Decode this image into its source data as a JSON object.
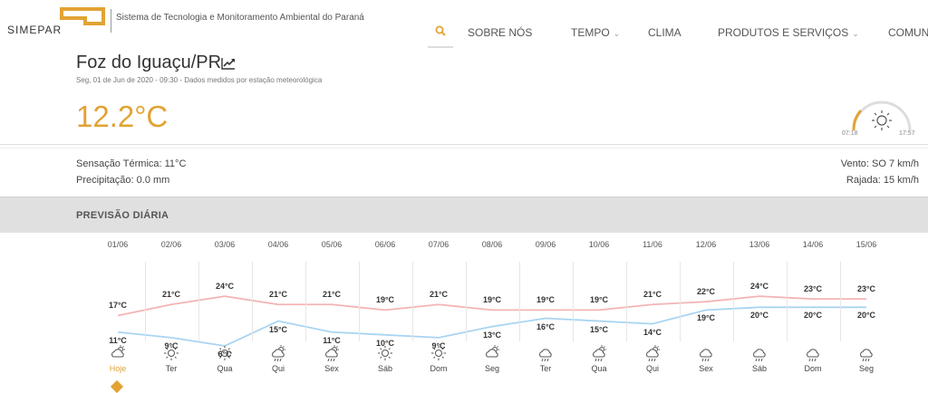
{
  "header": {
    "logo_text": "SIMEPAR",
    "tagline": "Sistema de Tecnologia e Monitoramento Ambiental do Paraná",
    "nav": [
      {
        "label": "SOBRE NÓS",
        "has_dropdown": false
      },
      {
        "label": "TEMPO",
        "has_dropdown": true
      },
      {
        "label": "CLIMA",
        "has_dropdown": false
      },
      {
        "label": "PRODUTOS E SERVIÇOS",
        "has_dropdown": true
      },
      {
        "label": "COMUN",
        "has_dropdown": false
      }
    ]
  },
  "current": {
    "city": "Foz do Iguaçu/PR",
    "subtitle": "Seg, 01 de Jun de 2020 - 09:30 - Dados medidos por estação meteorológica",
    "temperature": "12.2°C",
    "sunrise": "07:18",
    "sunset": "17:57",
    "feels_like": "Sensação Térmica: 11°C",
    "precipitation": "Precipitação: 0.0 mm",
    "wind": "Vento: SO 7 km/h",
    "gust": "Rajada: 15 km/h"
  },
  "forecast": {
    "section_title": "PREVISÃO DIÁRIA",
    "accent_color": "#e2a334",
    "max_color": "#f4b4b4",
    "min_color": "#a9d4f2",
    "days": [
      {
        "date": "01/06",
        "max": "17°C",
        "min": "11°C",
        "label": "Hoje",
        "icon": "sun-cloud-icon",
        "active": true
      },
      {
        "date": "02/06",
        "max": "21°C",
        "min": "9°C",
        "label": "Ter",
        "icon": "sun-icon"
      },
      {
        "date": "03/06",
        "max": "24°C",
        "min": "6°C",
        "label": "Qua",
        "icon": "sun-icon"
      },
      {
        "date": "04/06",
        "max": "21°C",
        "min": "15°C",
        "label": "Qui",
        "icon": "sun-rain-icon"
      },
      {
        "date": "05/06",
        "max": "21°C",
        "min": "11°C",
        "label": "Sex",
        "icon": "sun-rain-icon"
      },
      {
        "date": "06/06",
        "max": "19°C",
        "min": "10°C",
        "label": "Sáb",
        "icon": "sun-icon"
      },
      {
        "date": "07/06",
        "max": "21°C",
        "min": "9°C",
        "label": "Dom",
        "icon": "sun-icon"
      },
      {
        "date": "08/06",
        "max": "19°C",
        "min": "13°C",
        "label": "Seg",
        "icon": "sun-cloud-icon"
      },
      {
        "date": "09/06",
        "max": "19°C",
        "min": "16°C",
        "label": "Ter",
        "icon": "rain-icon"
      },
      {
        "date": "10/06",
        "max": "19°C",
        "min": "15°C",
        "label": "Qua",
        "icon": "sun-rain-icon"
      },
      {
        "date": "11/06",
        "max": "21°C",
        "min": "14°C",
        "label": "Qui",
        "icon": "sun-rain-icon"
      },
      {
        "date": "12/06",
        "max": "22°C",
        "min": "19°C",
        "label": "Sex",
        "icon": "rain-icon"
      },
      {
        "date": "13/06",
        "max": "24°C",
        "min": "20°C",
        "label": "Sáb",
        "icon": "rain-icon"
      },
      {
        "date": "14/06",
        "max": "23°C",
        "min": "20°C",
        "label": "Dom",
        "icon": "rain-icon"
      },
      {
        "date": "15/06",
        "max": "23°C",
        "min": "20°C",
        "label": "Seg",
        "icon": "rain-icon"
      }
    ]
  }
}
